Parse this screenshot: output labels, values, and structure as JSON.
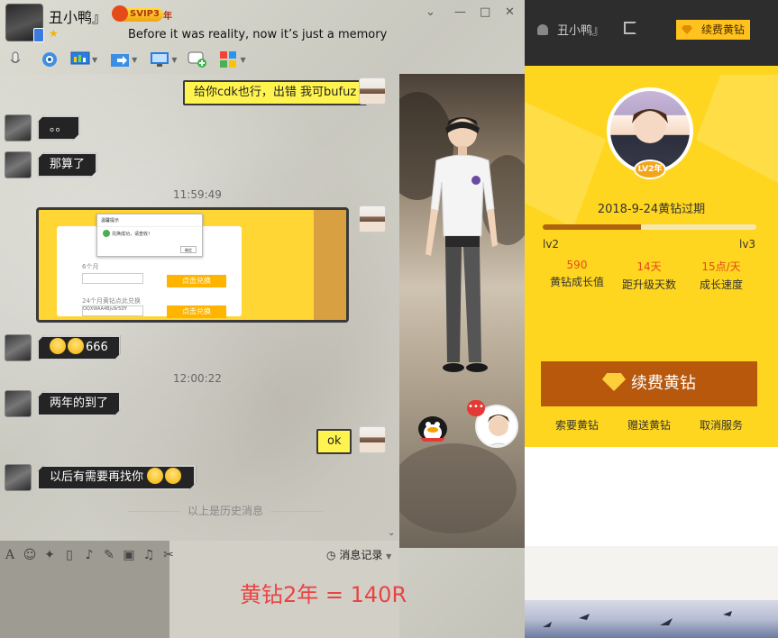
{
  "chat_header": {
    "contact_name": "丑小鸭』",
    "svip_label": "SVIP3",
    "year_label": "年",
    "signature": "Before it was reality, now it’s just a memory"
  },
  "messages": [
    {
      "side": "right",
      "text": "给你cdk也行，出错 我可bufuz"
    },
    {
      "side": "left",
      "text": "。。"
    },
    {
      "side": "left",
      "text": "那算了"
    },
    {
      "side": "time",
      "text": "11:59:49"
    },
    {
      "side": "right",
      "type": "image"
    },
    {
      "side": "left",
      "text": "666"
    },
    {
      "side": "time",
      "text": "12:00:22"
    },
    {
      "side": "left",
      "text": "两年的到了"
    },
    {
      "side": "right",
      "text": "ok"
    },
    {
      "side": "left",
      "text": "以后有需要再找你"
    }
  ],
  "image_msg": {
    "line1": "6个月",
    "btn1": "点击兑换",
    "line2": "24个月黄钻点此兑换",
    "field2": "OQXWAA4Bjv9r5DY",
    "btn2": "点击兑换",
    "dialog_title": "温馨提示",
    "dialog_text": "兑换成功，请查收！",
    "dialog_btn": "确定"
  },
  "history_divider": "以上是历史消息",
  "input_toolbar": {
    "message_record": "消息记录"
  },
  "annotation": "黄钻2年 = 140R",
  "panel": {
    "user_name": "丑小鸭』",
    "renew_top": "续费黄钻",
    "level_badge": "LV2年",
    "expire_text": "2018-9-24黄钻过期",
    "level_from": "lv2",
    "level_to": "lv3",
    "progress": 0.46,
    "stats": [
      {
        "value": "590",
        "label": "黄钻成长值"
      },
      {
        "value": "14天",
        "label": "距升级天数"
      },
      {
        "value": "15点/天",
        "label": "成长速度"
      }
    ],
    "renew_big": "续费黄钻",
    "links": [
      "索要黄钻",
      "赠送黄钻",
      "取消服务"
    ],
    "accent": "#ffd61f",
    "button_color": "#b7580d"
  }
}
